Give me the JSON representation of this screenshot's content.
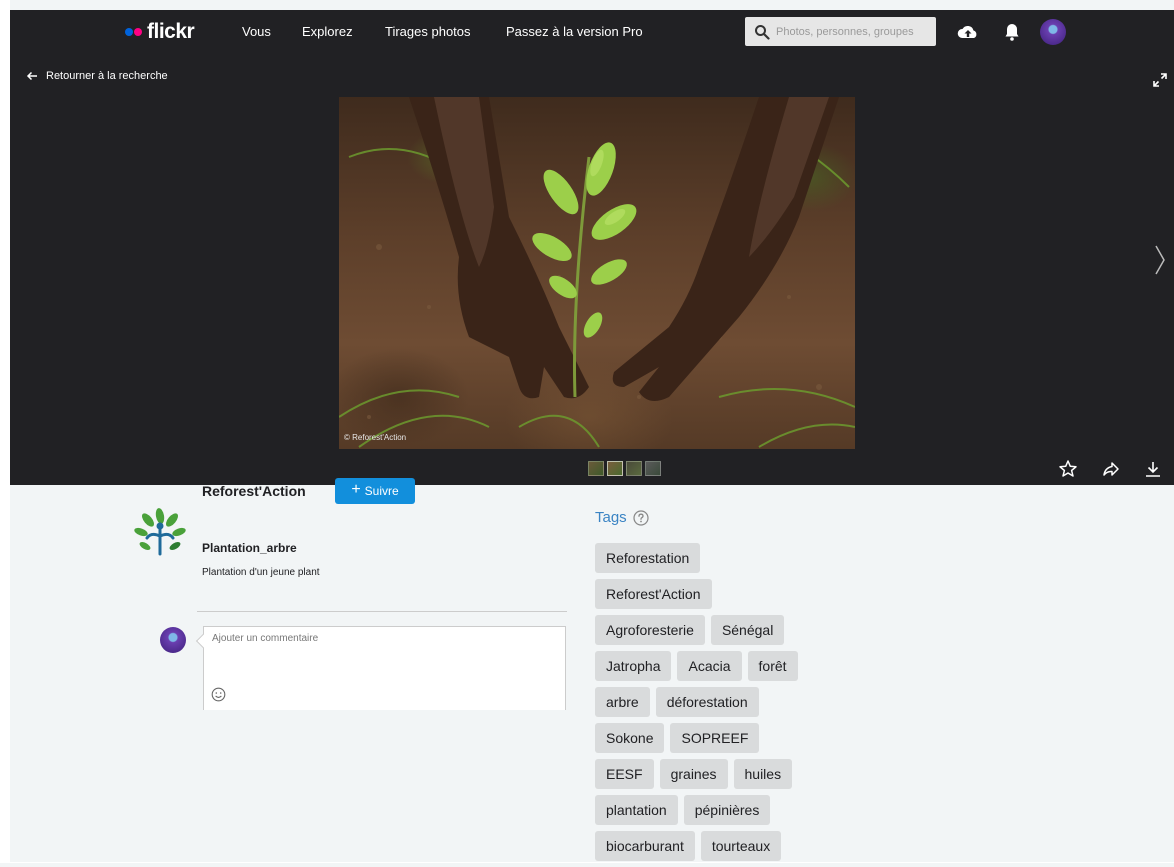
{
  "nav": {
    "logo_text": "flickr",
    "links": [
      "Vous",
      "Explorez",
      "Tirages photos",
      "Passez à la version Pro"
    ],
    "search_placeholder": "Photos, personnes, groupes",
    "icons": [
      "upload-cloud-icon",
      "bell-icon",
      "user-avatar"
    ]
  },
  "viewer": {
    "back_label": "Retourner à la recherche",
    "watermark": "© Reforest'Action",
    "thumbnail_count": 4,
    "active_thumbnail": 2,
    "actions": [
      "star-icon",
      "share-icon",
      "download-icon"
    ]
  },
  "owner": {
    "name": "Reforest'Action",
    "follow_label": "Suivre"
  },
  "photo": {
    "title": "Plantation_arbre",
    "description": "Plantation d'un jeune plant"
  },
  "comment": {
    "placeholder": "Ajouter un commentaire"
  },
  "tags": {
    "heading": "Tags",
    "rows": [
      [
        "Reforestation"
      ],
      [
        "Reforest'Action"
      ],
      [
        "Agroforesterie",
        "Sénégal"
      ],
      [
        "Jatropha",
        "Acacia",
        "forêt"
      ],
      [
        "arbre",
        "déforestation"
      ],
      [
        "Sokone",
        "SOPREEF"
      ],
      [
        "EESF",
        "graines",
        "huiles"
      ],
      [
        "plantation",
        "pépinières"
      ],
      [
        "biocarburant",
        "tourteaux"
      ]
    ]
  },
  "colors": {
    "nav_bg": "#212124",
    "follow_blue": "#128fdc",
    "tags_heading_blue": "#3b84c4",
    "tag_bg": "#d9dbdc",
    "flickr_blue": "#0063dc",
    "flickr_pink": "#ff0084"
  }
}
